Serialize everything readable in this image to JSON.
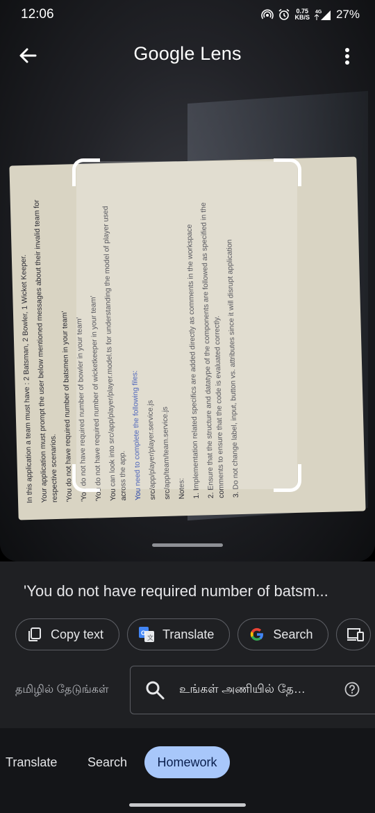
{
  "status": {
    "time": "12:06",
    "net_speed_value": "0.75",
    "net_speed_unit": "KB/S",
    "network": "4G",
    "battery": "27%"
  },
  "app": {
    "title_google": "Google",
    "title_lens": "Lens"
  },
  "document": {
    "lines": [
      "In this application a team must have : 2 Batsman, 2 Bowler, 1 Wicket Keeper.",
      "Your application must prompt the user below mentioned messages about their invalid team for respective scenarios.",
      "'You do not have required number of batsmen in your team'",
      "'You do not have required number of bowler in your team'",
      "'You do not have required number of wicketkeeper in your team'",
      "You can look into src/app/player/player.model.ts for understanding the model of player used across the app.",
      "You need to complete the following files:",
      "src/app/player/player.service.js",
      "src/app/team/team.service.js",
      "Notes:",
      "1. Implementation related specifics are added directly as comments in the workspace",
      "2. Ensure that the structure and datatype of the components are followed as specified in the comments to ensure that the code is evaluated correctly.",
      "3. Do not change label, input, button vs. attributes since it will disrupt application"
    ]
  },
  "result": {
    "text": "'You do not have required number of batsm..."
  },
  "actions": {
    "copy_text": "Copy text",
    "translate": "Translate",
    "search": "Search"
  },
  "search": {
    "lang_label": "தமிழில் தேடுங்கள்",
    "query": "உங்கள் அணியில் தேவை..."
  },
  "modes": {
    "translate": "Translate",
    "search": "Search",
    "homework": "Homework"
  },
  "colors": {
    "accent": "#a8c7fa",
    "sheet": "#1f2023"
  }
}
